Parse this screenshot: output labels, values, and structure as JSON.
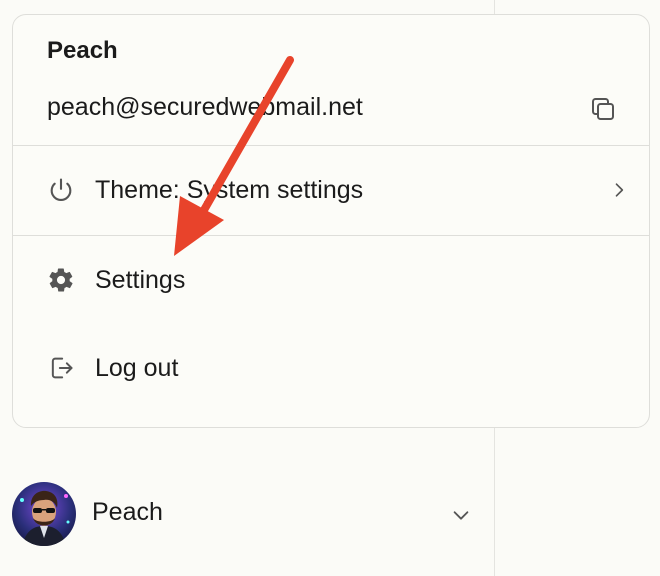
{
  "user_menu": {
    "name": "Peach",
    "email": "peach@securedwebmail.net",
    "copy_icon": "copy-icon",
    "items": [
      {
        "label": "Theme: System settings",
        "icon": "power-icon",
        "has_submenu": true
      },
      {
        "label": "Settings",
        "icon": "gear-icon",
        "has_submenu": false
      },
      {
        "label": "Log out",
        "icon": "logout-icon",
        "has_submenu": false
      }
    ]
  },
  "account_switcher": {
    "name": "Peach",
    "avatar": "avatar-image",
    "chevron": "chevron-down-icon"
  },
  "annotation": {
    "arrow_color": "#e8432b",
    "target": "Settings"
  }
}
